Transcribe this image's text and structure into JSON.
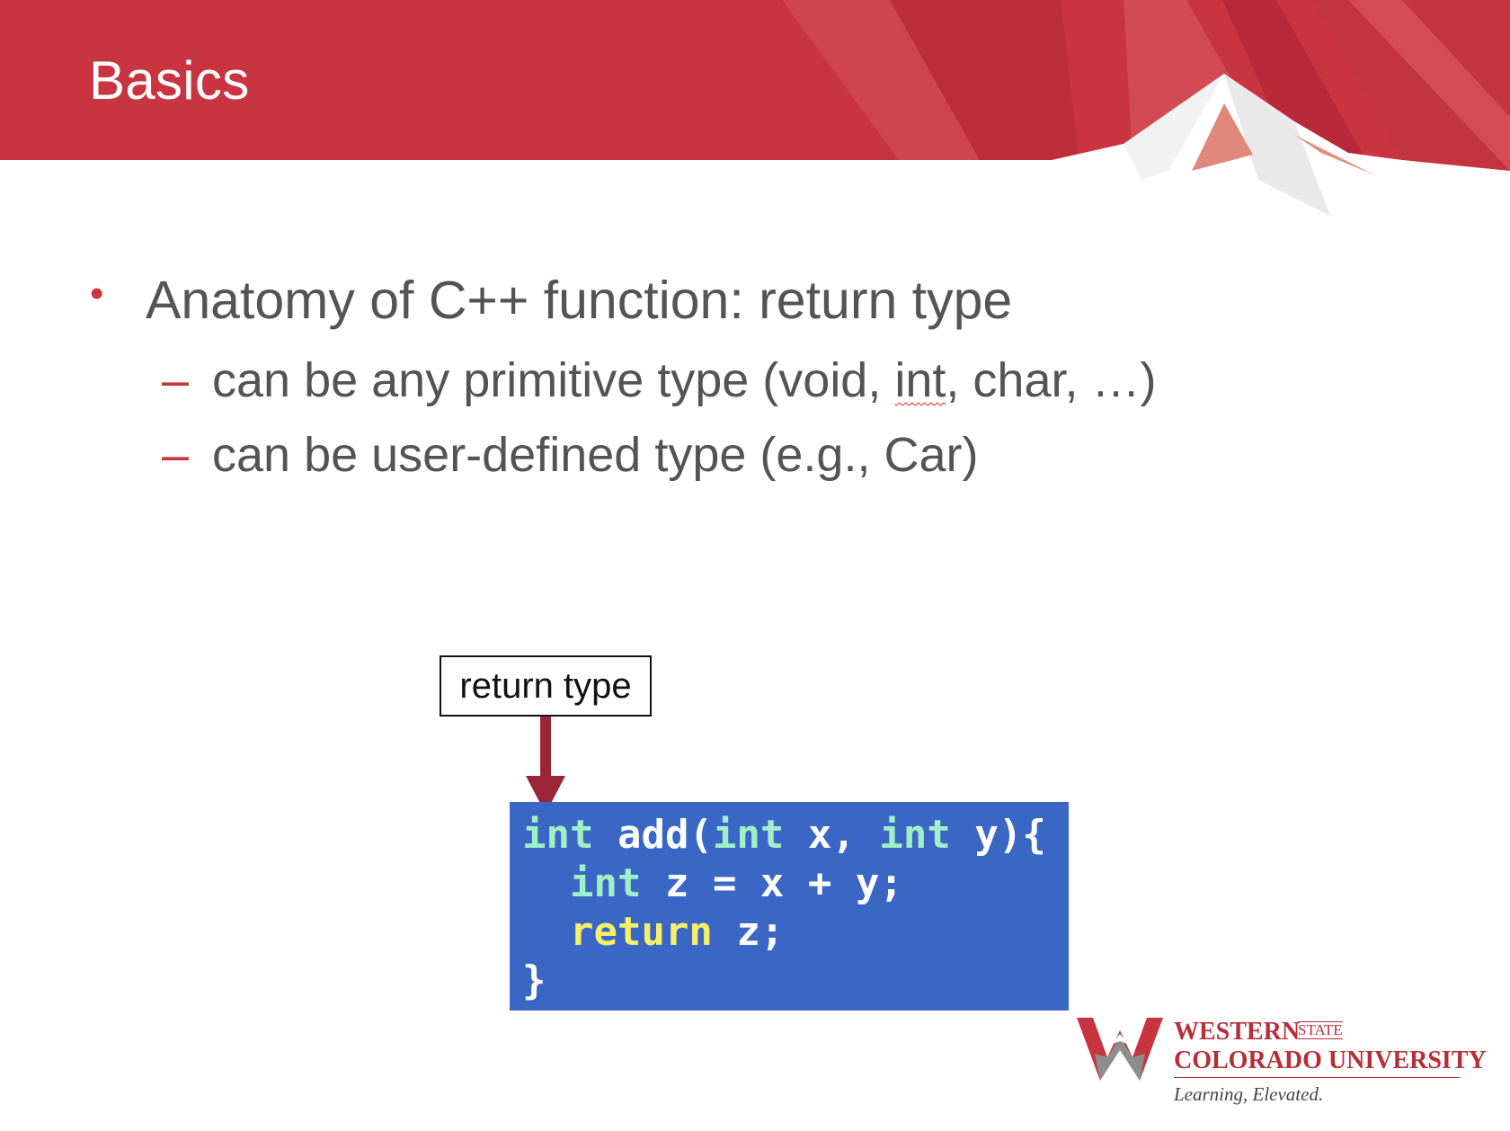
{
  "slide": {
    "title": "Basics"
  },
  "content": {
    "main_bullet": "Anatomy of C++ function: return type",
    "bullet_marker": "•",
    "sub_marker": "–",
    "sub_bullets": [
      {
        "before": "can be any primitive type (void, ",
        "flagged": "int",
        "after": ", char, …)"
      },
      {
        "text": "can be user-defined type (e.g., Car)"
      }
    ]
  },
  "diagram": {
    "callout_label": "return type",
    "code_lines": [
      {
        "k1": "int",
        "rest1": " add(",
        "k2": "int",
        "rest2": " x, ",
        "k3": "int",
        "rest3": " y){"
      },
      {
        "indent": "  ",
        "k1": "int",
        "rest1": " z = x + y;"
      },
      {
        "indent": "  ",
        "k1": "return",
        "rest1": " z;"
      },
      {
        "rest1": "}"
      }
    ]
  },
  "logo": {
    "line1": "WESTERN",
    "state": "STATE",
    "line2": "COLORADO UNIVERSITY",
    "tagline": "Learning, Elevated."
  },
  "colors": {
    "header_red": "#c8343f",
    "accent_red": "#c8343f",
    "code_bg": "#3a67c6",
    "code_keyword": "#9ff0c6",
    "code_return_keyword": "#f5ef6a",
    "arrow": "#9b2637"
  }
}
